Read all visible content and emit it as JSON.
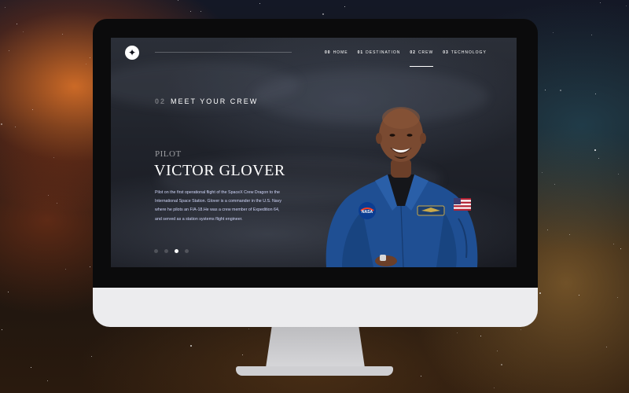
{
  "screen": {
    "nav": {
      "items": [
        {
          "num": "00",
          "label": "HOME",
          "active": false
        },
        {
          "num": "01",
          "label": "DESTINATION",
          "active": false
        },
        {
          "num": "02",
          "label": "CREW",
          "active": true
        },
        {
          "num": "03",
          "label": "TECHNOLOGY",
          "active": false
        }
      ]
    },
    "section": {
      "num": "02",
      "title": "MEET YOUR CREW"
    },
    "crew_member": {
      "role": "PILOT",
      "name": "VICTOR GLOVER",
      "bio": "Pilot on the first operational flight of the SpaceX Crew Dragon to the International Space Station. Glover is a commander in the U.S. Navy where he pilots an F/A-18.He was a crew member of Expedition 64, and served as a station systems flight engineer."
    },
    "carousel": {
      "count": 4,
      "active_index": 2
    }
  },
  "colors": {
    "screen_bg": "#20232b",
    "text_primary": "#ffffff",
    "text_secondary": "#d0d6f9",
    "monitor_bezel": "#0b0b0c",
    "monitor_chin": "#ececee",
    "suit_blue": "#1f4f93"
  },
  "icons": {
    "logo": "star-logo-icon"
  }
}
